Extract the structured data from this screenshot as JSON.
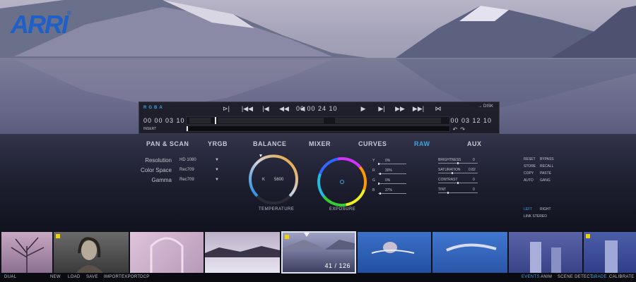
{
  "logo": {
    "text": "ARRI",
    "mark": "®"
  },
  "transport": {
    "channels": "RGBA",
    "buttons": [
      "step-mark-icon",
      "jump-start-icon",
      "prev-frame-icon",
      "rewind-icon",
      "play-back-icon",
      "play-icon",
      "next-frame-icon",
      "forward-icon",
      "jump-end-icon",
      "out-mark-icon"
    ],
    "button_glyphs": [
      "⊳|",
      "|◀◀",
      "|◀",
      "◀◀",
      "◀",
      "▶",
      "▶|",
      "▶▶",
      "▶▶|",
      "⋈"
    ],
    "timecode_current": "00 00 24 10",
    "timecode_in": "00 00 03 10",
    "timecode_out": "00 03 12 10",
    "disk_label": "→ DISK",
    "insert_label": "INSERT"
  },
  "tabs": [
    {
      "label": "PAN & SCAN",
      "active": false
    },
    {
      "label": "YRGB",
      "active": false
    },
    {
      "label": "BALANCE",
      "active": false
    },
    {
      "label": "MIXER",
      "active": false
    },
    {
      "label": "CURVES",
      "active": false
    },
    {
      "label": "RAW",
      "active": true
    },
    {
      "label": "AUX",
      "active": false
    }
  ],
  "pan_scan": {
    "resolution_label": "Resolution",
    "resolution_value": "HD 1080",
    "colorspace_label": "Color Space",
    "colorspace_value": "Rec709",
    "gamma_label": "Gamma",
    "gamma_value": "Rec709"
  },
  "balance": {
    "temperature_label": "TEMPERATURE",
    "k_label": "K",
    "k_value": "5600",
    "exposure_label": "EXPOSURE"
  },
  "mixer": [
    {
      "label": "Y",
      "value": "0%"
    },
    {
      "label": "R",
      "value": "30%"
    },
    {
      "label": "G",
      "value": "0%"
    },
    {
      "label": "B",
      "value": "37%"
    }
  ],
  "raw": [
    {
      "label": "BRIGHTNESS",
      "value": "0"
    },
    {
      "label": "SATURATION",
      "value": "0.82"
    },
    {
      "label": "CONTRAST",
      "value": "0"
    },
    {
      "label": "TINT",
      "value": "0"
    }
  ],
  "aux": {
    "col1": [
      "RESET",
      "STORE",
      "COPY",
      "AUTO"
    ],
    "col2": [
      "BYPASS",
      "RECALL",
      "PASTE",
      "GANG"
    ],
    "left": "LEFT",
    "right": "RIGHT",
    "link_stereo": "LINK STEREO"
  },
  "thumbnails": {
    "counter": "41 / 126"
  },
  "bottom": {
    "dual": "DUAL",
    "file_actions": [
      "NEW",
      "LOAD",
      "SAVE",
      "IMPORT",
      "EXPORT",
      "DCP"
    ],
    "modes": [
      {
        "label": "EVENTS",
        "active": true
      },
      {
        "label": "ANIM",
        "active": false
      },
      {
        "label": "SCENE DETECT...",
        "active": false
      },
      {
        "label": "GRADE",
        "active": true
      },
      {
        "label": "CALIBRATE",
        "active": false
      }
    ]
  },
  "colors": {
    "accent": "#3aa6e0",
    "marker": "#f0d400",
    "brand": "#1f5fc8"
  }
}
